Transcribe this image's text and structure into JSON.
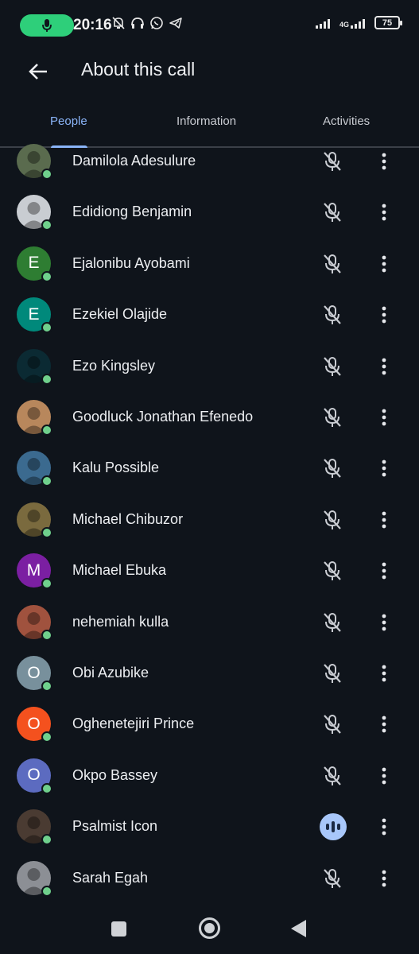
{
  "status_bar": {
    "time": "20:16",
    "network": "4G",
    "battery": "75",
    "icons": [
      "mic-icon",
      "bell-off-icon",
      "headphones-icon",
      "whatsapp-icon",
      "telegram-icon",
      "signal-icon",
      "signal-4g-icon",
      "battery-icon"
    ],
    "mic_pill_color": "#2ecf7a"
  },
  "header": {
    "title": "About this call",
    "back_icon": "arrow-left-icon"
  },
  "tabs": [
    {
      "label": "People",
      "active": true
    },
    {
      "label": "Information",
      "active": false
    },
    {
      "label": "Activities",
      "active": false
    }
  ],
  "colors": {
    "accent": "#8ab4f8",
    "background": "#0f141b",
    "online": "#6fd08c",
    "speaking": "#a8c7fa"
  },
  "participants": [
    {
      "name": "Damilola Adesulure",
      "avatar_type": "photo",
      "avatar_color": "#5a6b4e",
      "muted": true
    },
    {
      "name": "Edidiong Benjamin",
      "avatar_type": "photo",
      "avatar_color": "#c9cdd2",
      "muted": true
    },
    {
      "name": "Ejalonibu Ayobami",
      "avatar_type": "letter",
      "initial": "E",
      "avatar_color": "#2e7d32",
      "muted": true
    },
    {
      "name": "Ezekiel Olajide",
      "avatar_type": "letter",
      "initial": "E",
      "avatar_color": "#00897b",
      "muted": true
    },
    {
      "name": "Ezo Kingsley",
      "avatar_type": "photo",
      "avatar_color": "#0b2a33",
      "muted": true
    },
    {
      "name": "Goodluck Jonathan Efenedo",
      "avatar_type": "photo",
      "avatar_color": "#b8875c",
      "muted": true
    },
    {
      "name": "Kalu Possible",
      "avatar_type": "photo",
      "avatar_color": "#3b6a8f",
      "muted": true
    },
    {
      "name": "Michael Chibuzor",
      "avatar_type": "photo",
      "avatar_color": "#7a6a3e",
      "muted": true
    },
    {
      "name": "Michael Ebuka",
      "avatar_type": "letter",
      "initial": "M",
      "avatar_color": "#7b1fa2",
      "muted": true
    },
    {
      "name": "nehemiah kulla",
      "avatar_type": "photo",
      "avatar_color": "#a0523e",
      "muted": true
    },
    {
      "name": "Obi Azubike",
      "avatar_type": "letter",
      "initial": "O",
      "avatar_color": "#78909c",
      "muted": true
    },
    {
      "name": "Oghenetejiri Prince",
      "avatar_type": "letter",
      "initial": "O",
      "avatar_color": "#f4511e",
      "muted": true
    },
    {
      "name": "Okpo Bassey",
      "avatar_type": "letter",
      "initial": "O",
      "avatar_color": "#5c6bc0",
      "muted": true
    },
    {
      "name": "Psalmist Icon",
      "avatar_type": "photo",
      "avatar_color": "#4a3b32",
      "muted": false,
      "speaking": true
    },
    {
      "name": "Sarah Egah",
      "avatar_type": "photo",
      "avatar_color": "#8c8f95",
      "muted": true
    }
  ],
  "nav_bar": {
    "icons": [
      "recents-icon",
      "home-icon",
      "back-icon"
    ]
  }
}
